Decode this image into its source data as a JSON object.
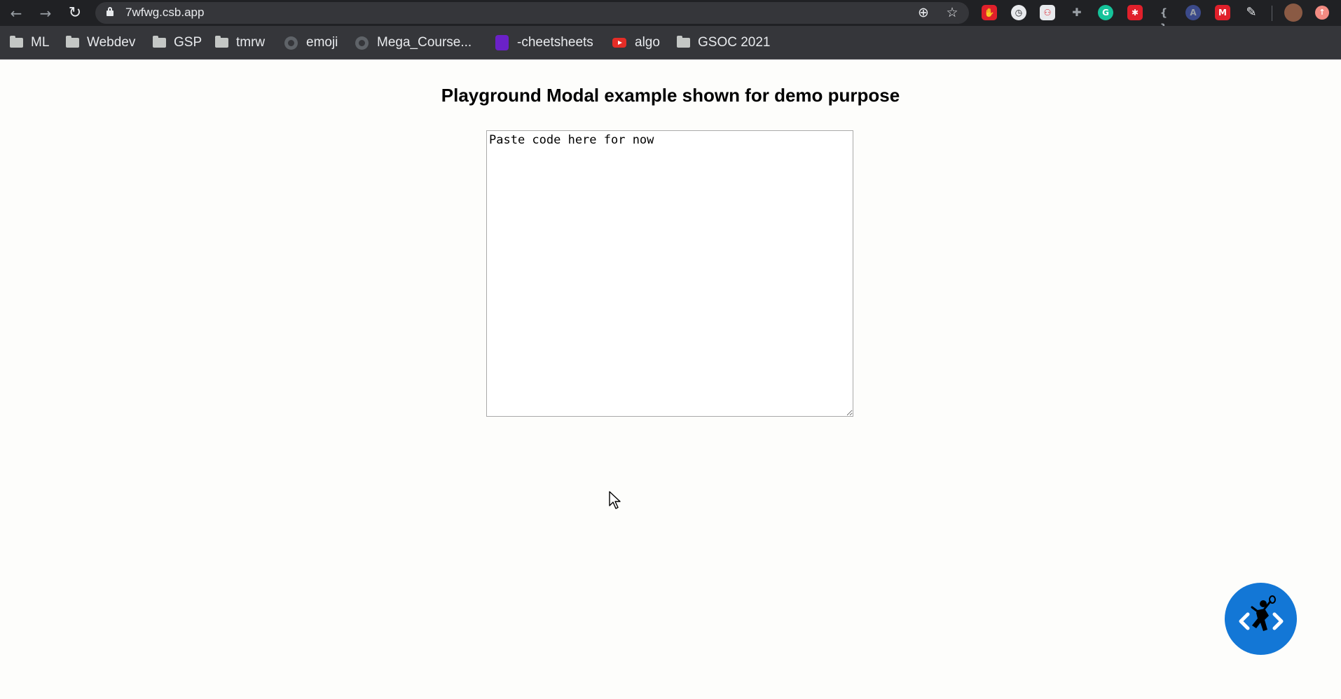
{
  "browser": {
    "url": "7wfwg.csb.app",
    "bookmarks": [
      {
        "label": "ML",
        "icon": "folder-icon"
      },
      {
        "label": "Webdev",
        "icon": "folder-icon"
      },
      {
        "label": "GSP",
        "icon": "folder-icon"
      },
      {
        "label": "tmrw",
        "icon": "folder-icon"
      },
      {
        "label": "emoji",
        "icon": "github-icon"
      },
      {
        "label": "Mega_Course...",
        "icon": "github-icon"
      },
      {
        "label": "-cheetsheets",
        "icon": "purple-doc-icon"
      },
      {
        "label": "algo",
        "icon": "youtube-icon"
      },
      {
        "label": "GSOC 2021",
        "icon": "folder-icon"
      }
    ],
    "extensions": [
      {
        "name": "ublock-icon",
        "color": "#e0202b"
      },
      {
        "name": "timer-icon",
        "color": "#e8eaed"
      },
      {
        "name": "mindmap-icon",
        "color": "#e8eaed"
      },
      {
        "name": "puzzle-extension-icon",
        "color": "#9aa0a6"
      },
      {
        "name": "grammarly-icon",
        "color": "#15c39a"
      },
      {
        "name": "hub-icon",
        "color": "#e0202b"
      },
      {
        "name": "json-icon",
        "color": "#9aa0a6"
      },
      {
        "name": "a-icon",
        "color": "#3b4a8a"
      },
      {
        "name": "gmail-m-icon",
        "color": "#e0202b"
      },
      {
        "name": "crow-icon",
        "color": "#e8eaed"
      }
    ]
  },
  "page": {
    "heading": "Playground Modal example shown for demo purpose",
    "editor_placeholder": "Paste code here for now"
  },
  "colors": {
    "accent": "#1377d6",
    "page_background": "#fdfdfb",
    "chrome_dark": "#202124"
  }
}
